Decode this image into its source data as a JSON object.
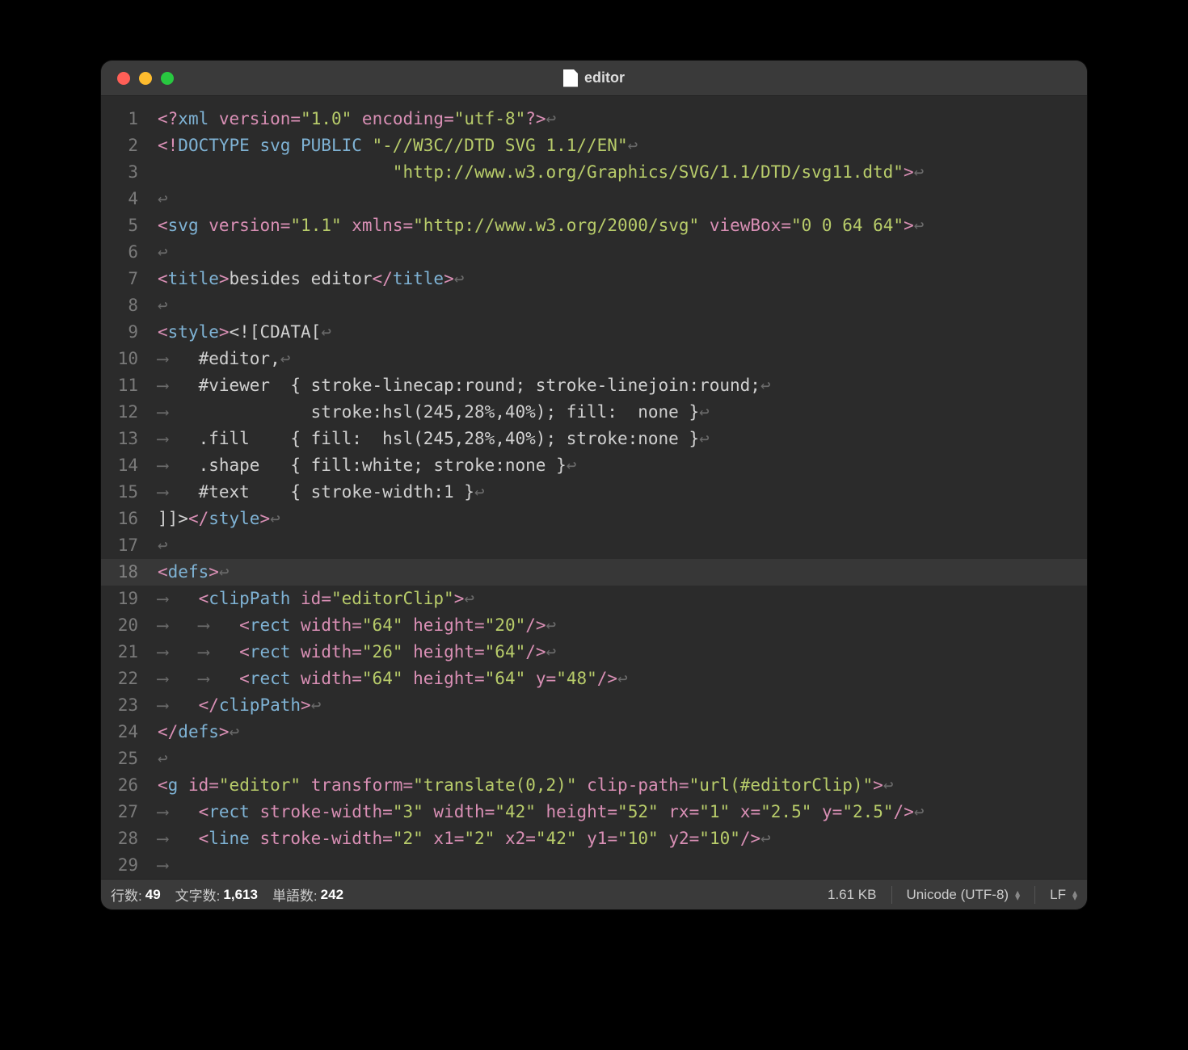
{
  "window": {
    "title": "editor"
  },
  "code": {
    "lines": [
      {
        "n": 1,
        "current": false,
        "tokens": [
          [
            "punc",
            "<?"
          ],
          [
            "tag",
            "xml "
          ],
          [
            "attr",
            "version"
          ],
          [
            "punc",
            "="
          ],
          [
            "str",
            "\"1.0\""
          ],
          [
            "text",
            " "
          ],
          [
            "attr",
            "encoding"
          ],
          [
            "punc",
            "="
          ],
          [
            "str",
            "\"utf-8\""
          ],
          [
            "punc",
            "?>"
          ],
          [
            "invis",
            "↩"
          ]
        ]
      },
      {
        "n": 2,
        "current": false,
        "tokens": [
          [
            "punc",
            "<!"
          ],
          [
            "tag",
            "DOCTYPE svg PUBLIC "
          ],
          [
            "str",
            "\"-//W3C//DTD SVG 1.1//EN\""
          ],
          [
            "invis",
            "↩"
          ]
        ]
      },
      {
        "n": 3,
        "current": false,
        "tokens": [
          [
            "text",
            "                       "
          ],
          [
            "str",
            "\"http://www.w3.org/Graphics/SVG/1.1/DTD/svg11.dtd\""
          ],
          [
            "punc",
            ">"
          ],
          [
            "invis",
            "↩"
          ]
        ]
      },
      {
        "n": 4,
        "current": false,
        "tokens": [
          [
            "invis",
            "↩"
          ]
        ]
      },
      {
        "n": 5,
        "current": false,
        "tokens": [
          [
            "punc",
            "<"
          ],
          [
            "tag",
            "svg "
          ],
          [
            "attr",
            "version"
          ],
          [
            "punc",
            "="
          ],
          [
            "str",
            "\"1.1\""
          ],
          [
            "text",
            " "
          ],
          [
            "attr",
            "xmlns"
          ],
          [
            "punc",
            "="
          ],
          [
            "str",
            "\"http://www.w3.org/2000/svg\""
          ],
          [
            "text",
            " "
          ],
          [
            "attr",
            "viewBox"
          ],
          [
            "punc",
            "="
          ],
          [
            "str",
            "\"0 0 64 64\""
          ],
          [
            "punc",
            ">"
          ],
          [
            "invis",
            "↩"
          ]
        ]
      },
      {
        "n": 6,
        "current": false,
        "tokens": [
          [
            "invis",
            "↩"
          ]
        ]
      },
      {
        "n": 7,
        "current": false,
        "tokens": [
          [
            "punc",
            "<"
          ],
          [
            "tag",
            "title"
          ],
          [
            "punc",
            ">"
          ],
          [
            "text",
            "besides editor"
          ],
          [
            "punc",
            "</"
          ],
          [
            "tag",
            "title"
          ],
          [
            "punc",
            ">"
          ],
          [
            "invis",
            "↩"
          ]
        ]
      },
      {
        "n": 8,
        "current": false,
        "tokens": [
          [
            "invis",
            "↩"
          ]
        ]
      },
      {
        "n": 9,
        "current": false,
        "tokens": [
          [
            "punc",
            "<"
          ],
          [
            "tag",
            "style"
          ],
          [
            "punc",
            ">"
          ],
          [
            "cdata",
            "<!"
          ],
          [
            "cdata",
            "[CDATA["
          ],
          [
            "invis",
            "↩"
          ]
        ]
      },
      {
        "n": 10,
        "current": false,
        "tokens": [
          [
            "invis",
            "⟶"
          ],
          [
            "css",
            "#editor,"
          ],
          [
            "invis",
            "↩"
          ]
        ]
      },
      {
        "n": 11,
        "current": false,
        "tokens": [
          [
            "invis",
            "⟶"
          ],
          [
            "css",
            "#viewer  { stroke-linecap:round; stroke-linejoin:round;"
          ],
          [
            "invis",
            "↩"
          ]
        ]
      },
      {
        "n": 12,
        "current": false,
        "tokens": [
          [
            "invis",
            "⟶"
          ],
          [
            "css",
            "           stroke:hsl(245,28%,40%); fill:  none }"
          ],
          [
            "invis",
            "↩"
          ]
        ]
      },
      {
        "n": 13,
        "current": false,
        "tokens": [
          [
            "invis",
            "⟶"
          ],
          [
            "css",
            ".fill    { fill:  hsl(245,28%,40%); stroke:none }"
          ],
          [
            "invis",
            "↩"
          ]
        ]
      },
      {
        "n": 14,
        "current": false,
        "tokens": [
          [
            "invis",
            "⟶"
          ],
          [
            "css",
            ".shape   { fill:white; stroke:none }"
          ],
          [
            "invis",
            "↩"
          ]
        ]
      },
      {
        "n": 15,
        "current": false,
        "tokens": [
          [
            "invis",
            "⟶"
          ],
          [
            "css",
            "#text    { stroke-width:1 }"
          ],
          [
            "invis",
            "↩"
          ]
        ]
      },
      {
        "n": 16,
        "current": false,
        "tokens": [
          [
            "cdata",
            "]]>"
          ],
          [
            "punc",
            "</"
          ],
          [
            "tag",
            "style"
          ],
          [
            "punc",
            ">"
          ],
          [
            "invis",
            "↩"
          ]
        ]
      },
      {
        "n": 17,
        "current": false,
        "tokens": [
          [
            "invis",
            "↩"
          ]
        ]
      },
      {
        "n": 18,
        "current": true,
        "tokens": [
          [
            "punc",
            "<"
          ],
          [
            "tag",
            "defs"
          ],
          [
            "punc",
            ">"
          ],
          [
            "invis",
            "↩"
          ]
        ]
      },
      {
        "n": 19,
        "current": false,
        "tokens": [
          [
            "invis",
            "⟶"
          ],
          [
            "punc",
            "<"
          ],
          [
            "tag",
            "clipPath "
          ],
          [
            "attr",
            "id"
          ],
          [
            "punc",
            "="
          ],
          [
            "str",
            "\"editorClip\""
          ],
          [
            "punc",
            ">"
          ],
          [
            "invis",
            "↩"
          ]
        ]
      },
      {
        "n": 20,
        "current": false,
        "tokens": [
          [
            "invis",
            "⟶"
          ],
          [
            "invis",
            "⟶"
          ],
          [
            "punc",
            "<"
          ],
          [
            "tag",
            "rect "
          ],
          [
            "attr",
            "width"
          ],
          [
            "punc",
            "="
          ],
          [
            "str",
            "\"64\""
          ],
          [
            "text",
            " "
          ],
          [
            "attr",
            "height"
          ],
          [
            "punc",
            "="
          ],
          [
            "str",
            "\"20\""
          ],
          [
            "punc",
            "/>"
          ],
          [
            "invis",
            "↩"
          ]
        ]
      },
      {
        "n": 21,
        "current": false,
        "tokens": [
          [
            "invis",
            "⟶"
          ],
          [
            "invis",
            "⟶"
          ],
          [
            "punc",
            "<"
          ],
          [
            "tag",
            "rect "
          ],
          [
            "attr",
            "width"
          ],
          [
            "punc",
            "="
          ],
          [
            "str",
            "\"26\""
          ],
          [
            "text",
            " "
          ],
          [
            "attr",
            "height"
          ],
          [
            "punc",
            "="
          ],
          [
            "str",
            "\"64\""
          ],
          [
            "punc",
            "/>"
          ],
          [
            "invis",
            "↩"
          ]
        ]
      },
      {
        "n": 22,
        "current": false,
        "tokens": [
          [
            "invis",
            "⟶"
          ],
          [
            "invis",
            "⟶"
          ],
          [
            "punc",
            "<"
          ],
          [
            "tag",
            "rect "
          ],
          [
            "attr",
            "width"
          ],
          [
            "punc",
            "="
          ],
          [
            "str",
            "\"64\""
          ],
          [
            "text",
            " "
          ],
          [
            "attr",
            "height"
          ],
          [
            "punc",
            "="
          ],
          [
            "str",
            "\"64\""
          ],
          [
            "text",
            " "
          ],
          [
            "attr",
            "y"
          ],
          [
            "punc",
            "="
          ],
          [
            "str",
            "\"48\""
          ],
          [
            "punc",
            "/>"
          ],
          [
            "invis",
            "↩"
          ]
        ]
      },
      {
        "n": 23,
        "current": false,
        "tokens": [
          [
            "invis",
            "⟶"
          ],
          [
            "punc",
            "</"
          ],
          [
            "tag",
            "clipPath"
          ],
          [
            "punc",
            ">"
          ],
          [
            "invis",
            "↩"
          ]
        ]
      },
      {
        "n": 24,
        "current": false,
        "tokens": [
          [
            "punc",
            "</"
          ],
          [
            "tag",
            "defs"
          ],
          [
            "punc",
            ">"
          ],
          [
            "invis",
            "↩"
          ]
        ]
      },
      {
        "n": 25,
        "current": false,
        "tokens": [
          [
            "invis",
            "↩"
          ]
        ]
      },
      {
        "n": 26,
        "current": false,
        "tokens": [
          [
            "punc",
            "<"
          ],
          [
            "tag",
            "g "
          ],
          [
            "attr",
            "id"
          ],
          [
            "punc",
            "="
          ],
          [
            "str",
            "\"editor\""
          ],
          [
            "text",
            " "
          ],
          [
            "attr",
            "transform"
          ],
          [
            "punc",
            "="
          ],
          [
            "str",
            "\"translate(0,2)\""
          ],
          [
            "text",
            " "
          ],
          [
            "attr",
            "clip-path"
          ],
          [
            "punc",
            "="
          ],
          [
            "str",
            "\"url(#editorClip)\""
          ],
          [
            "punc",
            ">"
          ],
          [
            "invis",
            "↩"
          ]
        ]
      },
      {
        "n": 27,
        "current": false,
        "tokens": [
          [
            "invis",
            "⟶"
          ],
          [
            "punc",
            "<"
          ],
          [
            "tag",
            "rect "
          ],
          [
            "attr",
            "stroke-width"
          ],
          [
            "punc",
            "="
          ],
          [
            "str",
            "\"3\""
          ],
          [
            "text",
            " "
          ],
          [
            "attr",
            "width"
          ],
          [
            "punc",
            "="
          ],
          [
            "str",
            "\"42\""
          ],
          [
            "text",
            " "
          ],
          [
            "attr",
            "height"
          ],
          [
            "punc",
            "="
          ],
          [
            "str",
            "\"52\""
          ],
          [
            "text",
            " "
          ],
          [
            "attr",
            "rx"
          ],
          [
            "punc",
            "="
          ],
          [
            "str",
            "\"1\""
          ],
          [
            "text",
            " "
          ],
          [
            "attr",
            "x"
          ],
          [
            "punc",
            "="
          ],
          [
            "str",
            "\"2.5\""
          ],
          [
            "text",
            " "
          ],
          [
            "attr",
            "y"
          ],
          [
            "punc",
            "="
          ],
          [
            "str",
            "\"2.5\""
          ],
          [
            "punc",
            "/>"
          ],
          [
            "invis",
            "↩"
          ]
        ]
      },
      {
        "n": 28,
        "current": false,
        "tokens": [
          [
            "invis",
            "⟶"
          ],
          [
            "punc",
            "<"
          ],
          [
            "tag",
            "line "
          ],
          [
            "attr",
            "stroke-width"
          ],
          [
            "punc",
            "="
          ],
          [
            "str",
            "\"2\""
          ],
          [
            "text",
            " "
          ],
          [
            "attr",
            "x1"
          ],
          [
            "punc",
            "="
          ],
          [
            "str",
            "\"2\""
          ],
          [
            "text",
            " "
          ],
          [
            "attr",
            "x2"
          ],
          [
            "punc",
            "="
          ],
          [
            "str",
            "\"42\""
          ],
          [
            "text",
            " "
          ],
          [
            "attr",
            "y1"
          ],
          [
            "punc",
            "="
          ],
          [
            "str",
            "\"10\""
          ],
          [
            "text",
            " "
          ],
          [
            "attr",
            "y2"
          ],
          [
            "punc",
            "="
          ],
          [
            "str",
            "\"10\""
          ],
          [
            "punc",
            "/>"
          ],
          [
            "invis",
            "↩"
          ]
        ]
      },
      {
        "n": 29,
        "current": false,
        "tokens": [
          [
            "invis",
            "⟶"
          ]
        ]
      }
    ]
  },
  "status": {
    "lines_label": "行数: ",
    "lines_value": "49",
    "chars_label": "文字数: ",
    "chars_value": "1,613",
    "words_label": "単語数: ",
    "words_value": "242",
    "filesize": "1.61 KB",
    "encoding": "Unicode (UTF-8)",
    "line_ending": "LF"
  }
}
